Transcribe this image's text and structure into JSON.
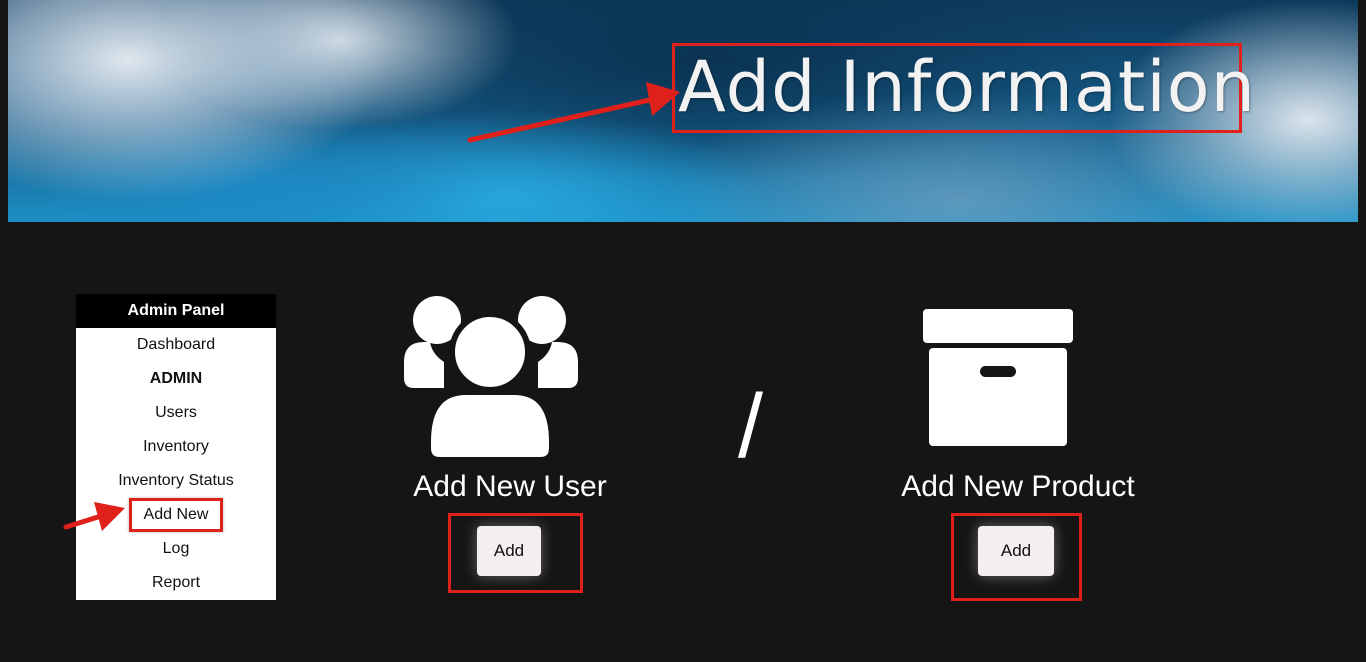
{
  "banner": {
    "title": "Add Information"
  },
  "sidebar": {
    "header": "Admin Panel",
    "items": [
      {
        "label": "Dashboard"
      },
      {
        "label": "ADMIN"
      },
      {
        "label": "Users"
      },
      {
        "label": "Inventory"
      },
      {
        "label": "Inventory Status"
      },
      {
        "label": "Add New"
      },
      {
        "label": "Log"
      },
      {
        "label": "Report"
      }
    ]
  },
  "main": {
    "user_card": {
      "icon": "users-group-icon",
      "title": "Add New User",
      "button_label": "Add"
    },
    "separator": "/",
    "product_card": {
      "icon": "archive-box-icon",
      "title": "Add New Product",
      "button_label": "Add"
    }
  },
  "colors": {
    "background": "#151515",
    "highlight": "#e0201b",
    "button_bg": "#f4eeee"
  }
}
